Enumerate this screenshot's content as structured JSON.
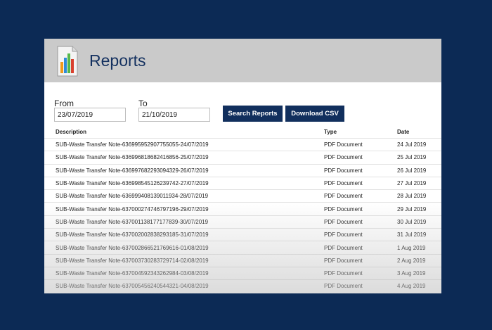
{
  "header": {
    "title": "Reports",
    "icon": "report-chart-icon"
  },
  "filters": {
    "from_label": "From",
    "from_value": "23/07/2019",
    "to_label": "To",
    "to_value": "21/10/2019",
    "search_label": "Search Reports",
    "download_label": "Download CSV"
  },
  "table": {
    "headers": {
      "description": "Description",
      "type": "Type",
      "date": "Date"
    },
    "rows": [
      {
        "description": "SUB-Waste Transfer Note-636995952907755055-24/07/2019",
        "type": "PDF Document",
        "date": "24 Jul 2019"
      },
      {
        "description": "SUB-Waste Transfer Note-636996818682416856-25/07/2019",
        "type": "PDF Document",
        "date": "25 Jul 2019"
      },
      {
        "description": "SUB-Waste Transfer Note-636997682293094329-26/07/2019",
        "type": "PDF Document",
        "date": "26 Jul 2019"
      },
      {
        "description": "SUB-Waste Transfer Note-636998545126239742-27/07/2019",
        "type": "PDF Document",
        "date": "27 Jul 2019"
      },
      {
        "description": "SUB-Waste Transfer Note-636999408139011934-28/07/2019",
        "type": "PDF Document",
        "date": "28 Jul 2019"
      },
      {
        "description": "SUB-Waste Transfer Note-637000274746797196-29/07/2019",
        "type": "PDF Document",
        "date": "29 Jul 2019"
      },
      {
        "description": "SUB-Waste Transfer Note-637001138177177839-30/07/2019",
        "type": "PDF Document",
        "date": "30 Jul 2019"
      },
      {
        "description": "SUB-Waste Transfer Note-637002002838293185-31/07/2019",
        "type": "PDF Document",
        "date": "31 Jul 2019"
      },
      {
        "description": "SUB-Waste Transfer Note-637002866521769616-01/08/2019",
        "type": "PDF Document",
        "date": "1 Aug 2019"
      },
      {
        "description": "SUB-Waste Transfer Note-637003730283729714-02/08/2019",
        "type": "PDF Document",
        "date": "2 Aug 2019"
      },
      {
        "description": "SUB-Waste Transfer Note-637004592343262984-03/08/2019",
        "type": "PDF Document",
        "date": "3 Aug 2019"
      },
      {
        "description": "SUB-Waste Transfer Note-637005456240544321-04/08/2019",
        "type": "PDF Document",
        "date": "4 Aug 2019"
      }
    ]
  }
}
